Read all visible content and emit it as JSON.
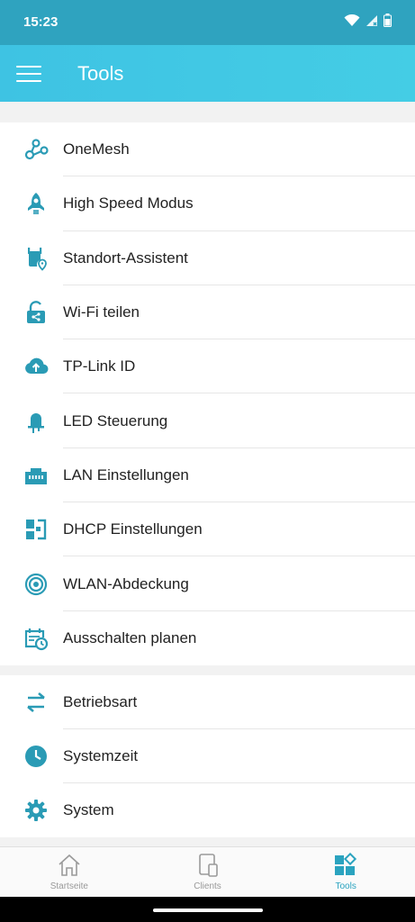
{
  "status_bar": {
    "time": "15:23"
  },
  "app_bar": {
    "title": "Tools"
  },
  "tools_group_1": [
    {
      "label": "OneMesh",
      "icon": "onemesh-icon"
    },
    {
      "label": "High Speed Modus",
      "icon": "rocket-icon"
    },
    {
      "label": "Standort-Assistent",
      "icon": "location-assistant-icon"
    },
    {
      "label": "Wi-Fi teilen",
      "icon": "share-wifi-icon"
    },
    {
      "label": "TP-Link ID",
      "icon": "cloud-upload-icon"
    },
    {
      "label": "LED Steuerung",
      "icon": "led-icon"
    },
    {
      "label": "LAN Einstellungen",
      "icon": "lan-port-icon"
    },
    {
      "label": "DHCP Einstellungen",
      "icon": "dhcp-icon"
    },
    {
      "label": "WLAN-Abdeckung",
      "icon": "coverage-icon"
    },
    {
      "label": "Ausschalten planen",
      "icon": "schedule-icon"
    }
  ],
  "tools_group_2": [
    {
      "label": "Betriebsart",
      "icon": "operation-mode-icon"
    },
    {
      "label": "Systemzeit",
      "icon": "clock-icon"
    },
    {
      "label": "System",
      "icon": "gear-icon"
    }
  ],
  "bottom_nav": {
    "home": "Startseite",
    "clients": "Clients",
    "tools": "Tools"
  },
  "colors": {
    "accent": "#2a9bb5",
    "app_bar": "#3ec3e3",
    "status_bar": "#2fa3bf"
  }
}
